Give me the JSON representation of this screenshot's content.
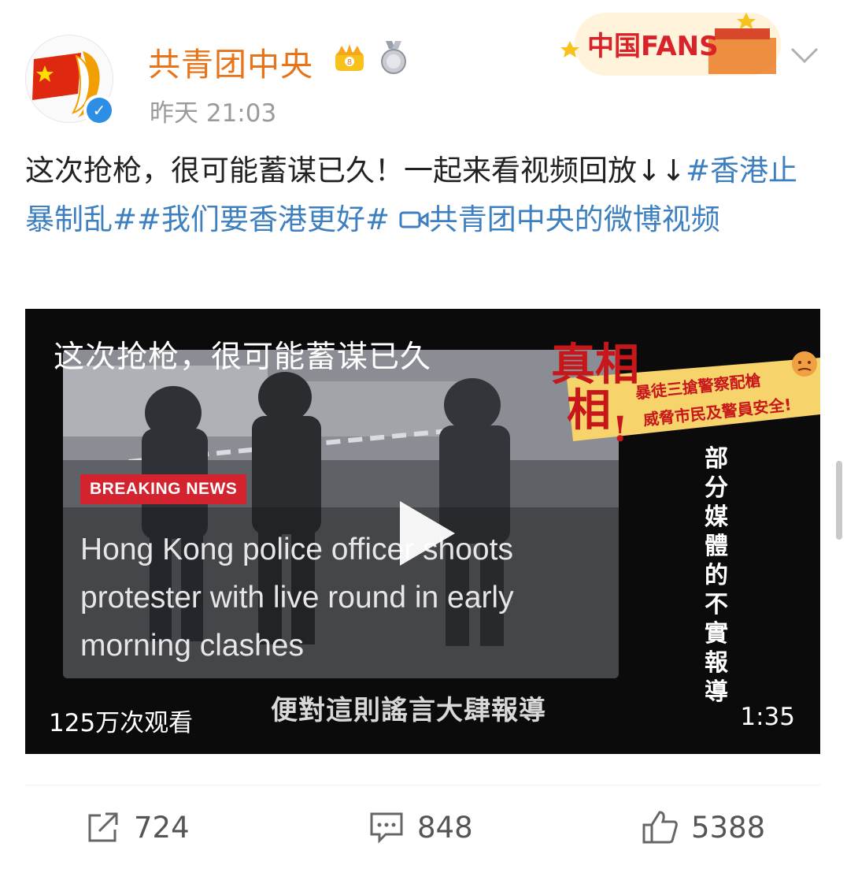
{
  "user": {
    "name": "共青团中央",
    "time": "昨天 21:03",
    "verified_icon": "blue-v-icon",
    "badges": [
      "crown-icon",
      "medal-icon"
    ],
    "fans_badge_text": "中国FANS"
  },
  "post": {
    "text_before": "这次抢枪，很可能蓄谋已久！一起来看视频回放↓↓",
    "tag1": "#香港止暴制乱#",
    "tag2": "#我们要香港更好#",
    "video_link": "共青团中央的微博视频"
  },
  "video": {
    "caption": "这次抢枪，很可能蓄谋已久",
    "truth_big": "真相",
    "truth_line1": "暴徒三搶警察配槍",
    "truth_line2": "威脅市民及警員安全!",
    "vertical": "部分媒體的不實報導",
    "breaking": "BREAKING NEWS",
    "headline": "Hong Kong police officer shoots protester with live round in early morning clashes",
    "subtitle": "便對這則謠言大肆報導",
    "views": "125万次观看",
    "duration": "1:35"
  },
  "actions": {
    "share_count": "724",
    "comment_count": "848",
    "like_count": "5388"
  },
  "colors": {
    "username": "#e8741a",
    "link": "#3e7fbf",
    "breaking_red": "#d3232f",
    "verified_blue": "#2d8ee6"
  }
}
